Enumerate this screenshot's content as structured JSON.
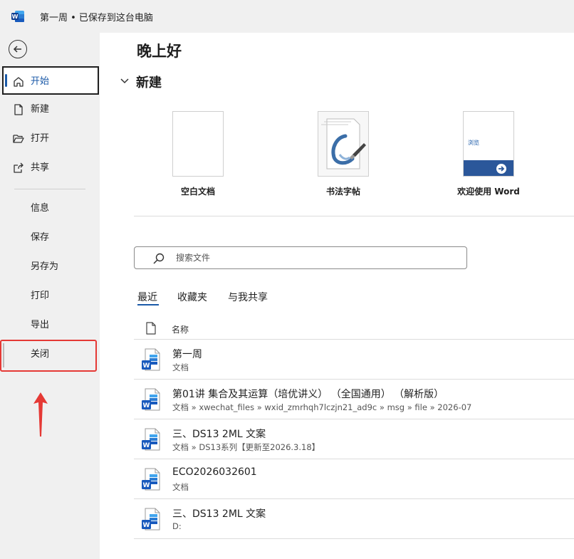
{
  "titlebar": {
    "title": "第一周 • 已保存到这台电脑",
    "logo_icon": "word-logo-icon"
  },
  "sidebar": {
    "back_icon": "back-arrow-icon",
    "items": [
      {
        "label": "开始",
        "icon": "home-icon",
        "active": true
      },
      {
        "label": "新建",
        "icon": "new-document-icon"
      },
      {
        "label": "打开",
        "icon": "folder-open-icon"
      },
      {
        "label": "共享",
        "icon": "share-icon"
      },
      {
        "label": "信息"
      },
      {
        "label": "保存"
      },
      {
        "label": "另存为"
      },
      {
        "label": "打印"
      },
      {
        "label": "导出"
      },
      {
        "label": "关闭"
      }
    ]
  },
  "main": {
    "greeting": "晚上好",
    "new_section_title": "新建",
    "templates": [
      {
        "label": "空白文档"
      },
      {
        "label": "书法字帖"
      },
      {
        "label": "欢迎使用 Word",
        "thumb_text": "浏览"
      }
    ],
    "search": {
      "placeholder": "搜索文件"
    },
    "tabs": [
      {
        "label": "最近",
        "active": true
      },
      {
        "label": "收藏夹"
      },
      {
        "label": "与我共享"
      }
    ],
    "column_header": "名称",
    "files": [
      {
        "name": "第一周",
        "path": "文档"
      },
      {
        "name": "第01讲 集合及其运算（培优讲义） （全国通用） （解析版）",
        "path": "文档 » xwechat_files » wxid_zmrhqh7lczjn21_ad9c » msg » file » 2026-07"
      },
      {
        "name": "三、DS13 2ML 文案",
        "path": "文档 » DS13系列【更新至2026.3.18】"
      },
      {
        "name": "ECO2026032601",
        "path": "文档"
      },
      {
        "name": "三、DS13 2ML 文案",
        "path": "D:"
      }
    ]
  },
  "colors": {
    "accent": "#1b5aa8",
    "highlight": "#e53935",
    "sidebar_bg": "#f0f0f0"
  }
}
